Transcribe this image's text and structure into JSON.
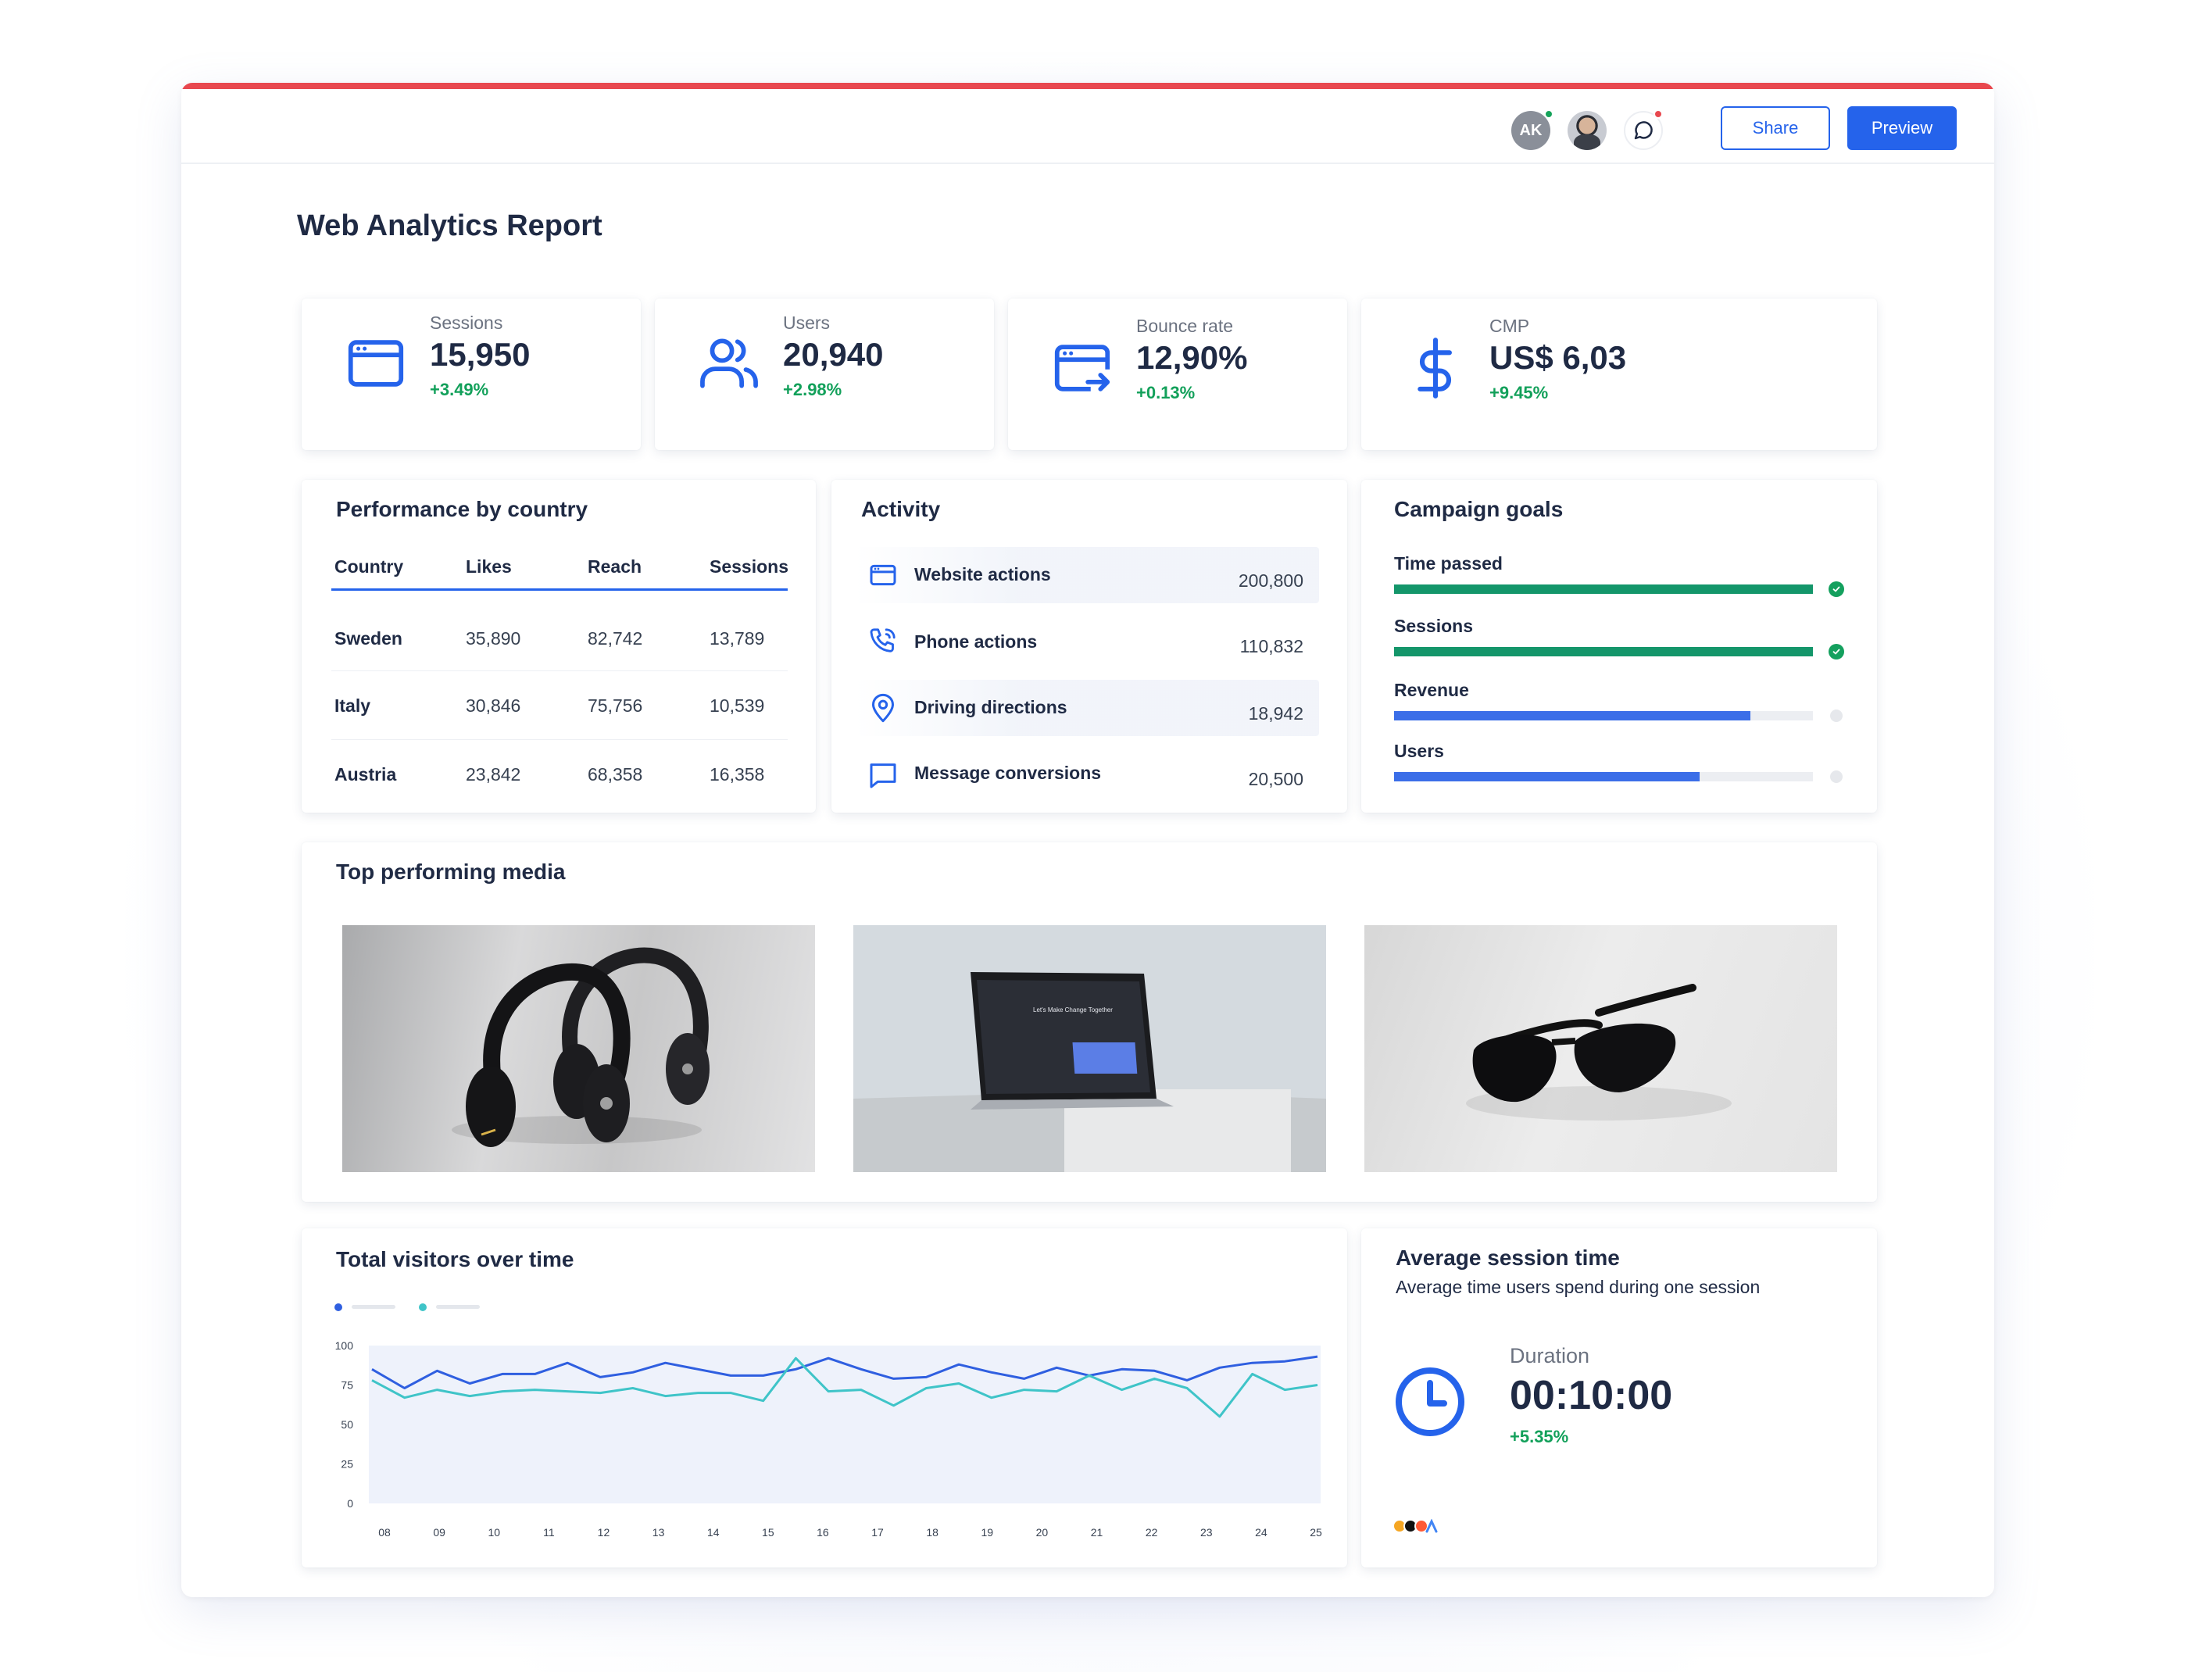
{
  "header": {
    "avatar_initials": "AK",
    "share_label": "Share",
    "preview_label": "Preview",
    "accent_color": "#e8484f",
    "primary_color": "#2563eb"
  },
  "page_title": "Web Analytics Report",
  "kpis": [
    {
      "label": "Sessions",
      "value": "15,950",
      "delta": "+3.49%",
      "icon": "browser-window-icon"
    },
    {
      "label": "Users",
      "value": "20,940",
      "delta": "+2.98%",
      "icon": "users-icon"
    },
    {
      "label": "Bounce rate",
      "value": "12,90%",
      "delta": "+0.13%",
      "icon": "browser-exit-icon"
    },
    {
      "label": "CMP",
      "value": "US$ 6,03",
      "delta": "+9.45%",
      "icon": "dollar-icon"
    }
  ],
  "performance": {
    "title": "Performance by country",
    "columns": [
      "Country",
      "Likes",
      "Reach",
      "Sessions"
    ],
    "rows": [
      [
        "Sweden",
        "35,890",
        "82,742",
        "13,789"
      ],
      [
        "Italy",
        "30,846",
        "75,756",
        "10,539"
      ],
      [
        "Austria",
        "23,842",
        "68,358",
        "16,358"
      ]
    ]
  },
  "activity": {
    "title": "Activity",
    "items": [
      {
        "label": "Website actions",
        "value": "200,800",
        "icon": "browser-window-icon"
      },
      {
        "label": "Phone actions",
        "value": "110,832",
        "icon": "phone-icon"
      },
      {
        "label": "Driving directions",
        "value": "18,942",
        "icon": "map-pin-icon"
      },
      {
        "label": "Message conversions",
        "value": "20,500",
        "icon": "message-icon"
      }
    ]
  },
  "campaign_goals": {
    "title": "Campaign goals",
    "goals": [
      {
        "label": "Time passed",
        "progress": 1.0,
        "color": "#14966a",
        "complete": true
      },
      {
        "label": "Sessions",
        "progress": 1.0,
        "color": "#14966a",
        "complete": true
      },
      {
        "label": "Revenue",
        "progress": 0.85,
        "color": "#3b6ee8",
        "complete": false
      },
      {
        "label": "Users",
        "progress": 0.73,
        "color": "#3b6ee8",
        "complete": false
      }
    ]
  },
  "media": {
    "title": "Top performing media",
    "items": [
      {
        "subject": "headphones"
      },
      {
        "subject": "laptop",
        "screen_text": "Let's Make Change Together"
      },
      {
        "subject": "sunglasses"
      }
    ]
  },
  "chart_data": {
    "title": "Total visitors over time",
    "type": "line",
    "x": [
      "08",
      "09",
      "10",
      "11",
      "12",
      "13",
      "14",
      "15",
      "16",
      "17",
      "18",
      "19",
      "20",
      "21",
      "22",
      "23",
      "24",
      "25"
    ],
    "yticks": [
      0,
      25,
      50,
      75,
      100
    ],
    "ylim": [
      0,
      100
    ],
    "series": [
      {
        "color": "#2f5fe0",
        "values": [
          85,
          73,
          84,
          76,
          82,
          82,
          89,
          80,
          83,
          89,
          85,
          81,
          81,
          85,
          92,
          85,
          79,
          80,
          88,
          83,
          79,
          86,
          81,
          85,
          84,
          78,
          86,
          89,
          90,
          93
        ]
      },
      {
        "color": "#3fc4c8",
        "values": [
          78,
          67,
          72,
          68,
          71,
          72,
          71,
          70,
          73,
          68,
          70,
          70,
          65,
          92,
          71,
          72,
          62,
          73,
          76,
          67,
          72,
          71,
          81,
          72,
          79,
          73,
          55,
          82,
          72,
          75
        ]
      }
    ],
    "legend": "top-left",
    "grid": false
  },
  "avg_session": {
    "title": "Average session time",
    "subtitle": "Average time users spend during one session",
    "duration_label": "Duration",
    "duration_value": "00:10:00",
    "delta": "+5.35%",
    "source_colors": [
      "#f5a623",
      "#111111",
      "#ff5a36",
      "#4285f4"
    ]
  }
}
